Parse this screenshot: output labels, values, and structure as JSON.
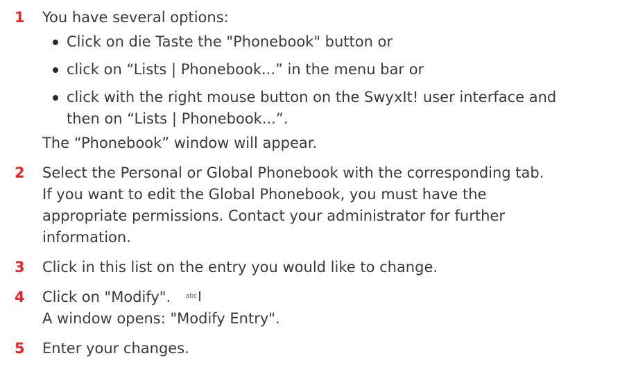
{
  "colors": {
    "step_number": "#e8262a",
    "text": "#3a3a3a"
  },
  "steps": [
    {
      "num": "1",
      "text": "You have several options:",
      "bullets": [
        "Click on die Taste the \"Phonebook\" button or",
        "click on “Lists | Phonebook...” in the menu bar or",
        "click with the right mouse button on the SwyxIt! user interface and",
        "then on “Lists | Phonebook...”."
      ],
      "after": "The “Phonebook” window will appear."
    },
    {
      "num": "2",
      "lines": [
        "Select the Personal or Global Phonebook with the corresponding tab.",
        "If you want to edit the Global Phonebook, you must have the",
        "appropriate permissions. Contact your administrator for further",
        "information."
      ]
    },
    {
      "num": "3",
      "text": "Click in this list on the entry you would like to change."
    },
    {
      "num": "4",
      "text": "Click on \"Modify\".",
      "icon": {
        "name": "abc-edit-icon",
        "label": "abc"
      },
      "after": "A window opens: \"Modify Entry\"."
    },
    {
      "num": "5",
      "text": "Enter your changes."
    }
  ]
}
